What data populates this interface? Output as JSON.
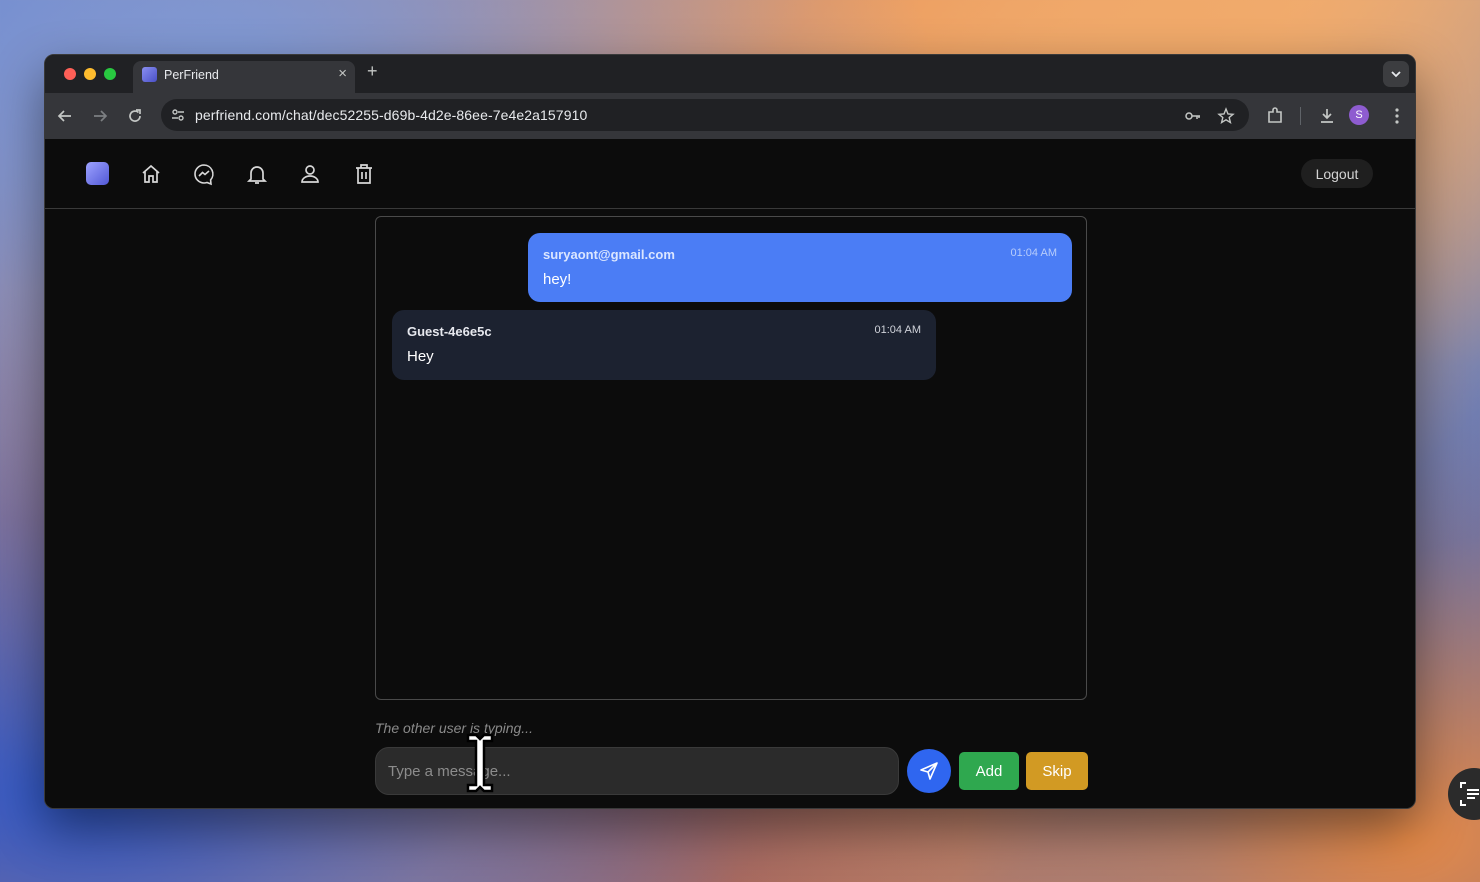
{
  "browser": {
    "tab_title": "PerFriend",
    "tab_close": "×",
    "new_tab": "+",
    "url": "perfriend.com/chat/dec52255-d69b-4d2e-86ee-7e4e2a157910",
    "profile_initial": "S"
  },
  "header": {
    "nav_icons": [
      "home-icon",
      "messenger-icon",
      "bell-icon",
      "user-icon",
      "trash-icon"
    ],
    "logout_label": "Logout"
  },
  "chat": {
    "messages": [
      {
        "sender": "suryaont@gmail.com",
        "time": "01:04 AM",
        "text": "hey!",
        "side": "right",
        "color": "#4b7df5"
      },
      {
        "sender": "Guest-4e6e5c",
        "time": "01:04 AM",
        "text": "Hey",
        "side": "left",
        "color": "#1c2230"
      }
    ],
    "typing_indicator": "The other user is typing...",
    "input_placeholder": "Type a message...",
    "add_label": "Add",
    "skip_label": "Skip"
  },
  "colors": {
    "send_button": "#2f66f0",
    "add_button": "#2fa84f",
    "skip_button": "#d29a23"
  }
}
